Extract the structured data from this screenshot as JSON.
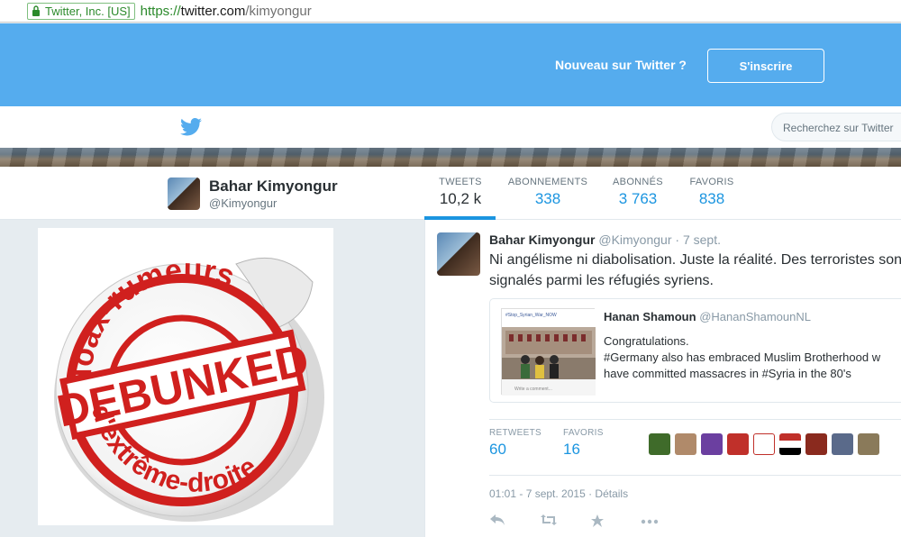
{
  "browser": {
    "ev_label": "Twitter, Inc. [US]",
    "url_scheme": "https://",
    "url_host": "twitter.com",
    "url_path": "/kimyongur"
  },
  "banner": {
    "prompt": "Nouveau sur Twitter ?",
    "signup_label": "S'inscrire"
  },
  "topnav": {
    "search_placeholder": "Recherchez sur Twitter"
  },
  "profile": {
    "name": "Bahar Kimyongur",
    "handle": "@Kimyongur",
    "stats": [
      {
        "label": "TWEETS",
        "value": "10,2 k",
        "active": true
      },
      {
        "label": "ABONNEMENTS",
        "value": "338"
      },
      {
        "label": "ABONNÉS",
        "value": "3 763"
      },
      {
        "label": "FAVORIS",
        "value": "838"
      }
    ]
  },
  "sidebar_image": {
    "line1": "Hoax-rumeurs",
    "line2": "DEBUNKED",
    "line3": "d'extrême-droite"
  },
  "tweet": {
    "author_name": "Bahar Kimyongur",
    "author_handle": "@Kimyongur",
    "date_short": "· 7 sept.",
    "text_line1": "Ni angélisme ni diabolisation. Juste la réalité. Des terroristes sont",
    "text_line2": "signalés parmi les réfugiés syriens.",
    "quote": {
      "name": "Hanan Shamoun",
      "handle": "@HananShamounNL",
      "line1": "Congratulations.",
      "line2": "#Germany also has embraced Muslim Brotherhood w",
      "line3": "have committed massacres in #Syria in the 80's",
      "thumb_caption": "#Stop_Syrian_War_NOW",
      "thumb_comment": "Write a comment..."
    },
    "retweets_label": "RETWEETS",
    "retweets": "60",
    "favorites_label": "FAVORIS",
    "favorites": "16",
    "timestamp": "01:01 - 7 sept. 2015 · Détails"
  }
}
